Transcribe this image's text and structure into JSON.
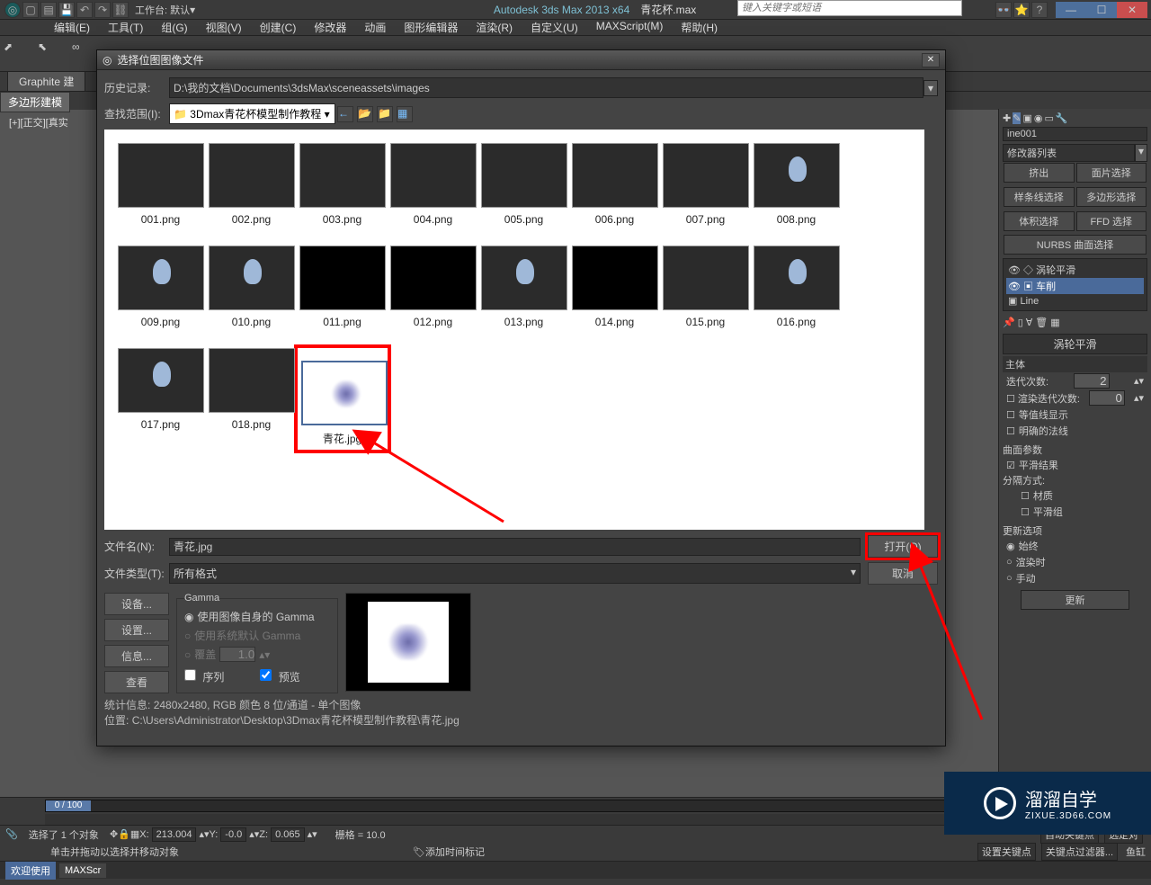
{
  "app": {
    "title": "Autodesk 3ds Max  2013 x64",
    "document": "青花杯.max",
    "workspace_label": "工作台: 默认",
    "search_placeholder": "键入关键字或短语"
  },
  "win_buttons": {
    "min": "—",
    "max": "☐",
    "close": "✕"
  },
  "menu": [
    {
      "label": "编辑(E)"
    },
    {
      "label": "工具(T)"
    },
    {
      "label": "组(G)"
    },
    {
      "label": "视图(V)"
    },
    {
      "label": "创建(C)"
    },
    {
      "label": "修改器"
    },
    {
      "label": "动画"
    },
    {
      "label": "图形编辑器"
    },
    {
      "label": "渲染(R)"
    },
    {
      "label": "自定义(U)"
    },
    {
      "label": "MAXScript(M)"
    },
    {
      "label": "帮助(H)"
    }
  ],
  "graphite": {
    "tab": "Graphite 建",
    "active": "多边形建模"
  },
  "viewport": {
    "label": "[+][正交][真实"
  },
  "dialog": {
    "title": "选择位图图像文件",
    "history_label": "历史记录:",
    "history_path": "D:\\我的文档\\Documents\\3dsMax\\sceneassets\\images",
    "lookin_label": "查找范围(I):",
    "lookin_value": "3Dmax青花杯模型制作教程",
    "files": [
      {
        "name": "001.png",
        "type": "dark"
      },
      {
        "name": "002.png",
        "type": "dark"
      },
      {
        "name": "003.png",
        "type": "dark"
      },
      {
        "name": "004.png",
        "type": "dark"
      },
      {
        "name": "005.png",
        "type": "dark"
      },
      {
        "name": "006.png",
        "type": "dark"
      },
      {
        "name": "007.png",
        "type": "dark"
      },
      {
        "name": "008.png",
        "type": "goblet"
      },
      {
        "name": "009.png",
        "type": "goblet"
      },
      {
        "name": "010.png",
        "type": "goblet"
      },
      {
        "name": "011.png",
        "type": "black"
      },
      {
        "name": "012.png",
        "type": "black"
      },
      {
        "name": "013.png",
        "type": "goblet"
      },
      {
        "name": "014.png",
        "type": "black"
      },
      {
        "name": "015.png",
        "type": "dark"
      },
      {
        "name": "016.png",
        "type": "goblet"
      },
      {
        "name": "017.png",
        "type": "goblet"
      },
      {
        "name": "018.png",
        "type": "dark"
      },
      {
        "name": "青花.jpg",
        "type": "jpeg",
        "selected": true
      }
    ],
    "filename_label": "文件名(N):",
    "filename_value": "青花.jpg",
    "filetype_label": "文件类型(T):",
    "filetype_value": "所有格式",
    "open_btn": "打开(O)",
    "cancel_btn": "取消",
    "device_btn": "设备...",
    "setup_btn": "设置...",
    "info_btn": "信息...",
    "view_btn": "查看",
    "gamma": {
      "legend": "Gamma",
      "own": "使用图像自身的 Gamma",
      "system": "使用系统默认 Gamma",
      "override": "覆盖",
      "override_value": "1.0"
    },
    "sequence": "序列",
    "preview": "预览",
    "stats_label": "统计信息:",
    "stats_value": "2480x2480, RGB 颜色 8 位/通道 - 单个图像",
    "location_label": "位置:",
    "location_value": "C:\\Users\\Administrator\\Desktop\\3Dmax青花杯模型制作教程\\青花.jpg"
  },
  "right": {
    "object_name": "ine001",
    "modlist_label": "修改器列表",
    "btn_extrude": "挤出",
    "btn_facesel": "面片选择",
    "btn_splinesel": "样条线选择",
    "btn_polysel": "多边形选择",
    "btn_volsel": "体积选择",
    "btn_ffdsel": "FFD 选择",
    "nurbs": "NURBS 曲面选择",
    "tree": [
      {
        "label": "涡轮平滑",
        "active": false
      },
      {
        "label": "车削",
        "active": true
      },
      {
        "label": "Line",
        "active": false
      }
    ],
    "turbo_header": "涡轮平滑",
    "main_label": "主体",
    "iter_label": "迭代次数:",
    "iter_value": "2",
    "render_iter_label": "渲染迭代次数:",
    "render_iter_value": "0",
    "iso_label": "等值线显示",
    "normals_label": "明确的法线",
    "surf_label": "曲面参数",
    "smooth_label": "平滑结果",
    "sep_label": "分隔方式:",
    "material_label": "材质",
    "smoothgrp_label": "平滑组",
    "update_header": "更新选项",
    "always": "始终",
    "onrender": "渲染时",
    "manual": "手动",
    "update_btn": "更新"
  },
  "timeline": {
    "pos": "0 / 100"
  },
  "status": {
    "sel": "选择了 1 个对象",
    "hint": "单击并拖动以选择并移动对象",
    "x_label": "X:",
    "x": "213.004",
    "y_label": "Y:",
    "y": "-0.0",
    "z_label": "Z:",
    "z": "0.065",
    "grid": "栅格 = 10.0",
    "autokey": "自动关键点",
    "selset": "选定对",
    "setkey": "设置关键点",
    "keyfilter": "关键点过滤器...",
    "addtime": "添加时间标记",
    "fish": "鱼缸"
  },
  "welcome": {
    "a": "欢迎使用",
    "b": "MAXScr"
  },
  "watermark": {
    "main": "溜溜自学",
    "sub": "ZIXUE.3D66.COM"
  }
}
